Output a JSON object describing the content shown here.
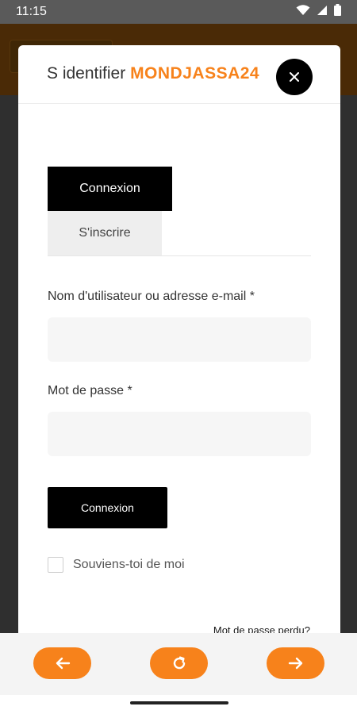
{
  "status_bar": {
    "time": "11:15",
    "icons": [
      "wifi-icon",
      "signal-icon",
      "battery-icon"
    ]
  },
  "modal": {
    "title_prefix": "S identifier",
    "title_brand": "MONDJASSA24",
    "close_icon": "close-icon",
    "tabs": [
      {
        "label": "Connexion",
        "active": true
      },
      {
        "label": "S'inscrire",
        "active": false
      }
    ],
    "form": {
      "username_label": "Nom d'utilisateur ou adresse e-mail *",
      "username_value": "",
      "password_label": "Mot de passe *",
      "password_value": "",
      "submit_label": "Connexion",
      "remember_label": "Souviens-toi de moi",
      "remember_checked": false,
      "lost_password": "Mot de passe perdu?"
    }
  },
  "bottom_nav": {
    "buttons": [
      {
        "name": "back-button",
        "icon": "arrow-left-icon"
      },
      {
        "name": "reload-button",
        "icon": "reload-icon"
      },
      {
        "name": "forward-button",
        "icon": "arrow-right-icon"
      }
    ]
  },
  "colors": {
    "accent": "#f7821b",
    "black": "#000000",
    "input_bg": "#f6f6f6",
    "status_bar": "#5a5a5a"
  }
}
